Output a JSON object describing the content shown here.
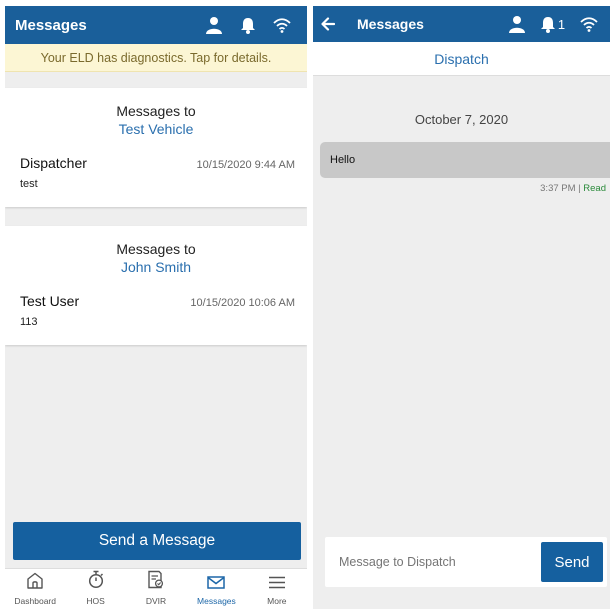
{
  "left": {
    "header": {
      "title": "Messages"
    },
    "banner": "Your ELD has diagnostics. Tap for details.",
    "cards": [
      {
        "to_label": "Messages to",
        "to_name": "Test Vehicle",
        "sender": "Dispatcher",
        "time": "10/15/2020 9:44 AM",
        "preview": "test"
      },
      {
        "to_label": "Messages to",
        "to_name": "John Smith",
        "sender": "Test User",
        "time": "10/15/2020 10:06 AM",
        "preview": "113"
      }
    ],
    "send_button": "Send a Message",
    "tabs": [
      {
        "label": "Dashboard",
        "icon": "home-icon"
      },
      {
        "label": "HOS",
        "icon": "stopwatch-icon"
      },
      {
        "label": "DVIR",
        "icon": "inspection-report-icon"
      },
      {
        "label": "Messages",
        "icon": "envelope-icon",
        "active": true
      },
      {
        "label": "More",
        "icon": "menu-icon"
      }
    ]
  },
  "right": {
    "header": {
      "title": "Messages",
      "notification_count": "1"
    },
    "subtitle": "Dispatch",
    "date": "October 7, 2020",
    "message": {
      "text": "Hello",
      "time": "3:37 PM",
      "separator": "|",
      "status": "Read"
    },
    "composer": {
      "placeholder": "Message to Dispatch",
      "send_label": "Send"
    }
  },
  "colors": {
    "primary": "#1a5f9a",
    "link": "#2a6fae",
    "banner_bg": "#fcf6d4",
    "read": "#2a8a3a",
    "background": "#eeeeee"
  }
}
